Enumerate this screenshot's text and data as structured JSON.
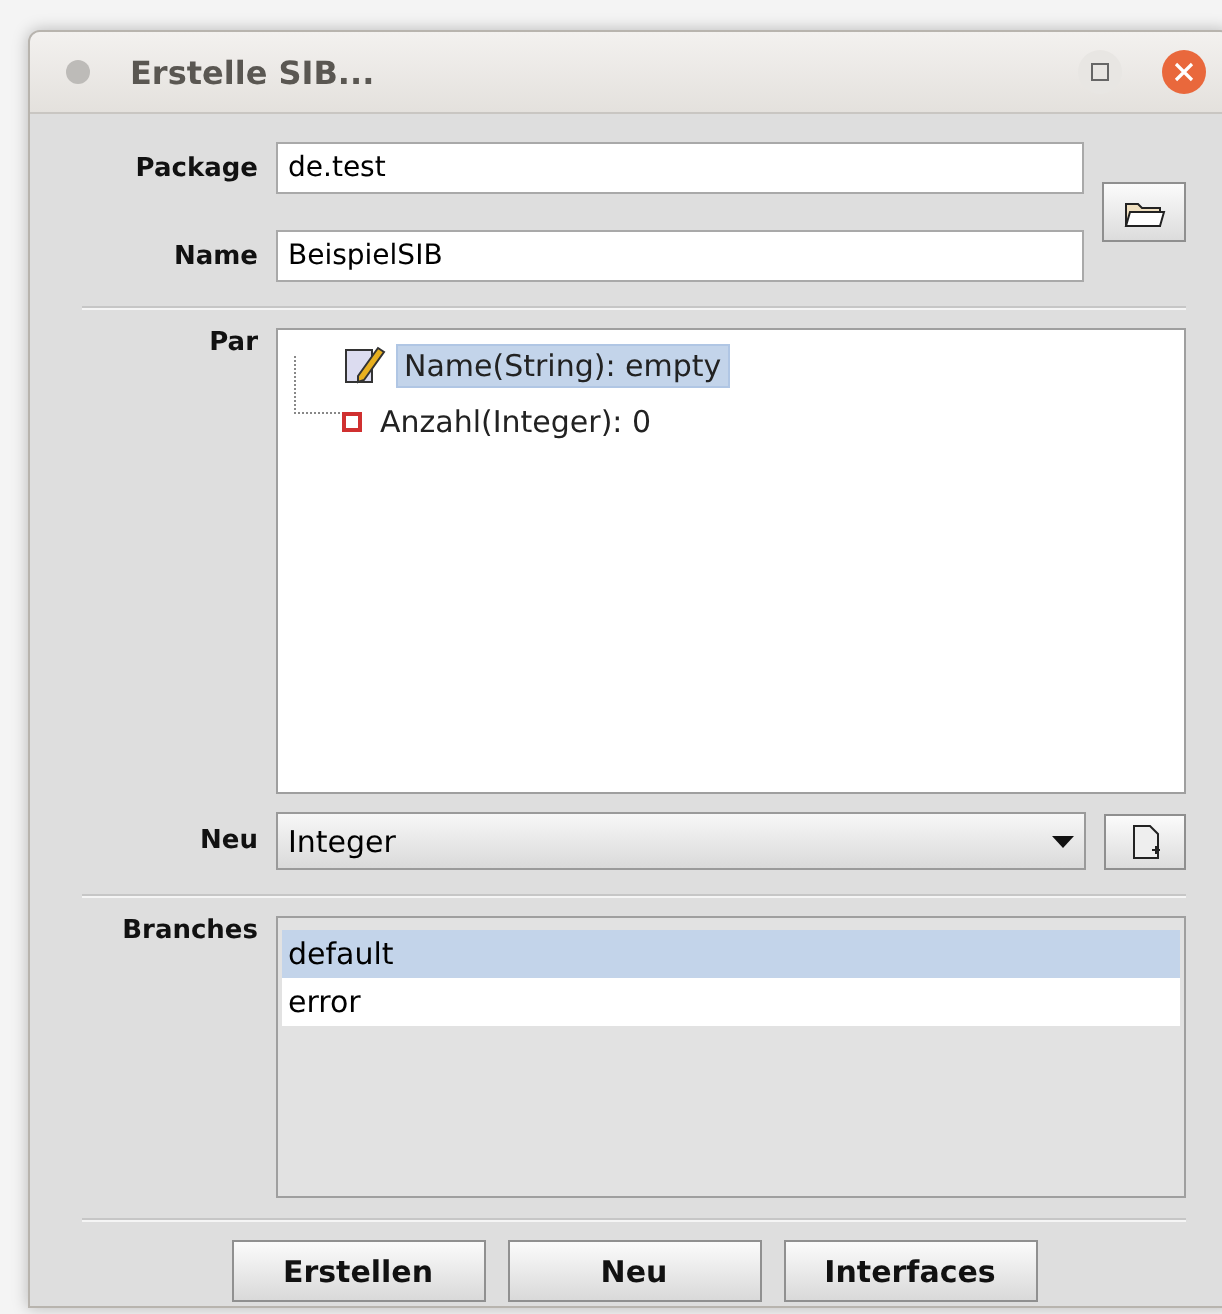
{
  "window": {
    "title": "Erstelle SIB..."
  },
  "package": {
    "label": "Package",
    "value": "de.test"
  },
  "name": {
    "label": "Name",
    "value": "BeispielSIB"
  },
  "parameters": {
    "label": "Par",
    "items": [
      {
        "kind": "edit",
        "text": "Name(String): empty",
        "selected": true
      },
      {
        "kind": "value",
        "text": "Anzahl(Integer): 0",
        "selected": false
      }
    ]
  },
  "new_type": {
    "label": "Neu",
    "value": "Integer"
  },
  "branches": {
    "label": "Branches",
    "items": [
      {
        "text": "default",
        "selected": true
      },
      {
        "text": "error",
        "selected": false
      }
    ]
  },
  "buttons": [
    "Erstellen",
    "Neu",
    "Interfaces"
  ]
}
